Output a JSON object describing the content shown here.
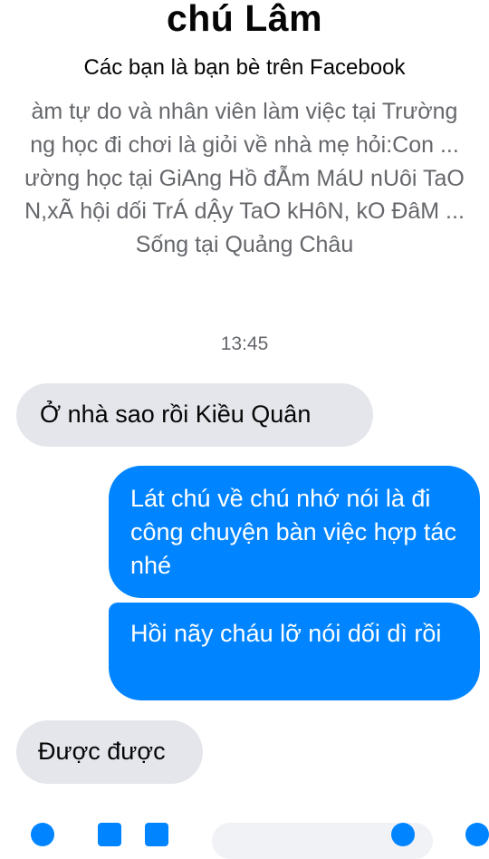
{
  "header": {
    "name": "chú Lâm",
    "friends_line": "Các bạn là bạn bè trên Facebook",
    "info_lines": [
      "àm tự do và nhân viên làm việc tại Trường",
      "ng học đi chơi là giỏi về nhà mẹ hỏi:Con ...",
      "ường học tại GiAng Hồ đẪm MáU nUôi TaO",
      "N,xÃ hội dối TrÁ dẬy TaO kHôN, kO ĐâM ...",
      "Sống tại Quảng Châu"
    ]
  },
  "conversation": {
    "timestamp": "13:45",
    "messages": [
      {
        "direction": "incoming",
        "text": "Ở nhà sao rồi Kiều Quân"
      },
      {
        "direction": "outgoing",
        "text": "Lát chú về chú nhớ nói là đi công chuyện bàn việc hợp tác nhé"
      },
      {
        "direction": "outgoing",
        "text": "Hồi nãy cháu lỡ nói dối dì rồi"
      },
      {
        "direction": "incoming",
        "text": "Được được"
      }
    ]
  },
  "colors": {
    "outgoing_bubble": "#0084ff",
    "incoming_bubble": "#e4e6eb",
    "secondary_text": "#65676b"
  },
  "composer": {
    "icons": [
      "plus-icon",
      "camera-icon",
      "image-icon",
      "mic-icon",
      "emoji-icon",
      "like-icon"
    ]
  }
}
